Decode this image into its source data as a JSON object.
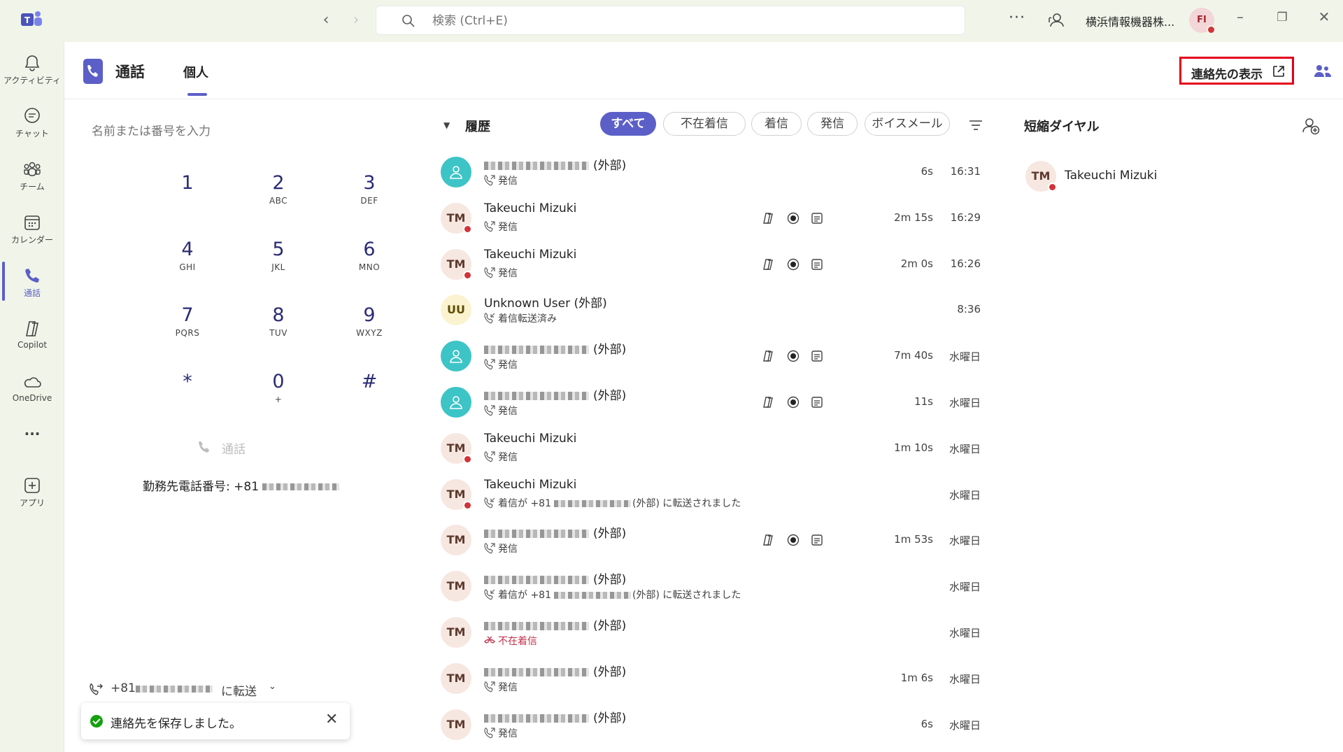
{
  "titlebar": {
    "search_placeholder": "検索 (Ctrl+E)",
    "org_name": "横浜情報機器株...",
    "avatar_initials": "FI",
    "more": "···"
  },
  "rail": {
    "items": [
      {
        "label": "アクティビティ"
      },
      {
        "label": "チャット"
      },
      {
        "label": "チーム"
      },
      {
        "label": "カレンダー"
      },
      {
        "label": "通話"
      },
      {
        "label": "Copilot"
      },
      {
        "label": "OneDrive"
      },
      {
        "label": "···"
      },
      {
        "label": "アプリ"
      }
    ]
  },
  "header": {
    "title": "通話",
    "tab": "個人",
    "show_contacts": "連絡先の表示"
  },
  "dialer": {
    "placeholder": "名前または番号を入力",
    "keys": [
      {
        "num": "1",
        "sub": ""
      },
      {
        "num": "2",
        "sub": "ABC"
      },
      {
        "num": "3",
        "sub": "DEF"
      },
      {
        "num": "4",
        "sub": "GHI"
      },
      {
        "num": "5",
        "sub": "JKL"
      },
      {
        "num": "6",
        "sub": "MNO"
      },
      {
        "num": "7",
        "sub": "PQRS"
      },
      {
        "num": "8",
        "sub": "TUV"
      },
      {
        "num": "9",
        "sub": "WXYZ"
      },
      {
        "num": "*",
        "sub": ""
      },
      {
        "num": "0",
        "sub": "+"
      },
      {
        "num": "#",
        "sub": ""
      }
    ],
    "call_label": "通話",
    "work_phone_label": "勤務先電話番号: +81",
    "forward_prefix": "+81",
    "forward_suffix": "に転送",
    "toast_message": "連絡先を保存しました。"
  },
  "history": {
    "title": "履歴",
    "filters": [
      "すべて",
      "不在着信",
      "着信",
      "発信",
      "ボイスメール"
    ],
    "rows": [
      {
        "avatar": "ext",
        "initials": "",
        "name": "(外部)",
        "masked": true,
        "sub": "発信",
        "subtype": "out",
        "actions": false,
        "duration": "6s",
        "time": "16:31"
      },
      {
        "avatar": "tm",
        "initials": "TM",
        "name": "Takeuchi Mizuki",
        "masked": false,
        "sub": "発信",
        "subtype": "out",
        "actions": true,
        "duration": "2m 15s",
        "time": "16:29"
      },
      {
        "avatar": "tm",
        "initials": "TM",
        "name": "Takeuchi Mizuki",
        "masked": false,
        "sub": "発信",
        "subtype": "out",
        "actions": true,
        "duration": "2m 0s",
        "time": "16:26"
      },
      {
        "avatar": "uu",
        "initials": "UU",
        "name": "Unknown User (外部)",
        "masked": false,
        "sub": "着信転送済み",
        "subtype": "fwd",
        "actions": false,
        "duration": "",
        "time": "8:36"
      },
      {
        "avatar": "ext",
        "initials": "",
        "name": "(外部)",
        "masked": true,
        "sub": "発信",
        "subtype": "out",
        "actions": true,
        "duration": "7m 40s",
        "time": "水曜日"
      },
      {
        "avatar": "ext",
        "initials": "",
        "name": "(外部)",
        "masked": true,
        "sub": "発信",
        "subtype": "out",
        "actions": true,
        "duration": "11s",
        "time": "水曜日"
      },
      {
        "avatar": "tm",
        "initials": "TM",
        "name": "Takeuchi Mizuki",
        "masked": false,
        "sub": "発信",
        "subtype": "out",
        "actions": false,
        "duration": "1m 10s",
        "time": "水曜日"
      },
      {
        "avatar": "tm",
        "initials": "TM",
        "name": "Takeuchi Mizuki",
        "masked": false,
        "sub": "着信が +81",
        "sub_tail": "(外部) に転送されました",
        "subtype": "fwd",
        "actions": false,
        "duration": "",
        "time": "水曜日"
      },
      {
        "avatar": "tm2",
        "initials": "TM",
        "name": "(外部)",
        "masked": true,
        "sub": "発信",
        "subtype": "out",
        "actions": true,
        "duration": "1m 53s",
        "time": "水曜日"
      },
      {
        "avatar": "tm2",
        "initials": "TM",
        "name": "(外部)",
        "masked": true,
        "sub": "着信が +81",
        "sub_tail": "(外部) に転送されました",
        "subtype": "fwd",
        "actions": false,
        "duration": "",
        "time": "水曜日"
      },
      {
        "avatar": "tm2",
        "initials": "TM",
        "name": "(外部)",
        "masked": true,
        "sub": "不在着信",
        "subtype": "missed",
        "actions": false,
        "duration": "",
        "time": "水曜日"
      },
      {
        "avatar": "tm2",
        "initials": "TM",
        "name": "(外部)",
        "masked": true,
        "sub": "発信",
        "subtype": "out",
        "actions": false,
        "duration": "1m 6s",
        "time": "水曜日"
      },
      {
        "avatar": "tm2",
        "initials": "TM",
        "name": "(外部)",
        "masked": true,
        "sub": "発信",
        "subtype": "out",
        "actions": false,
        "duration": "6s",
        "time": "水曜日"
      }
    ]
  },
  "speed_dial": {
    "title": "短縮ダイヤル",
    "contacts": [
      {
        "initials": "TM",
        "name": "Takeuchi Mizuki"
      }
    ]
  },
  "colors": {
    "accent": "#5b5fc7",
    "presence_busy": "#d13438",
    "highlight_box": "#e3001b",
    "missed": "#c4314b"
  }
}
